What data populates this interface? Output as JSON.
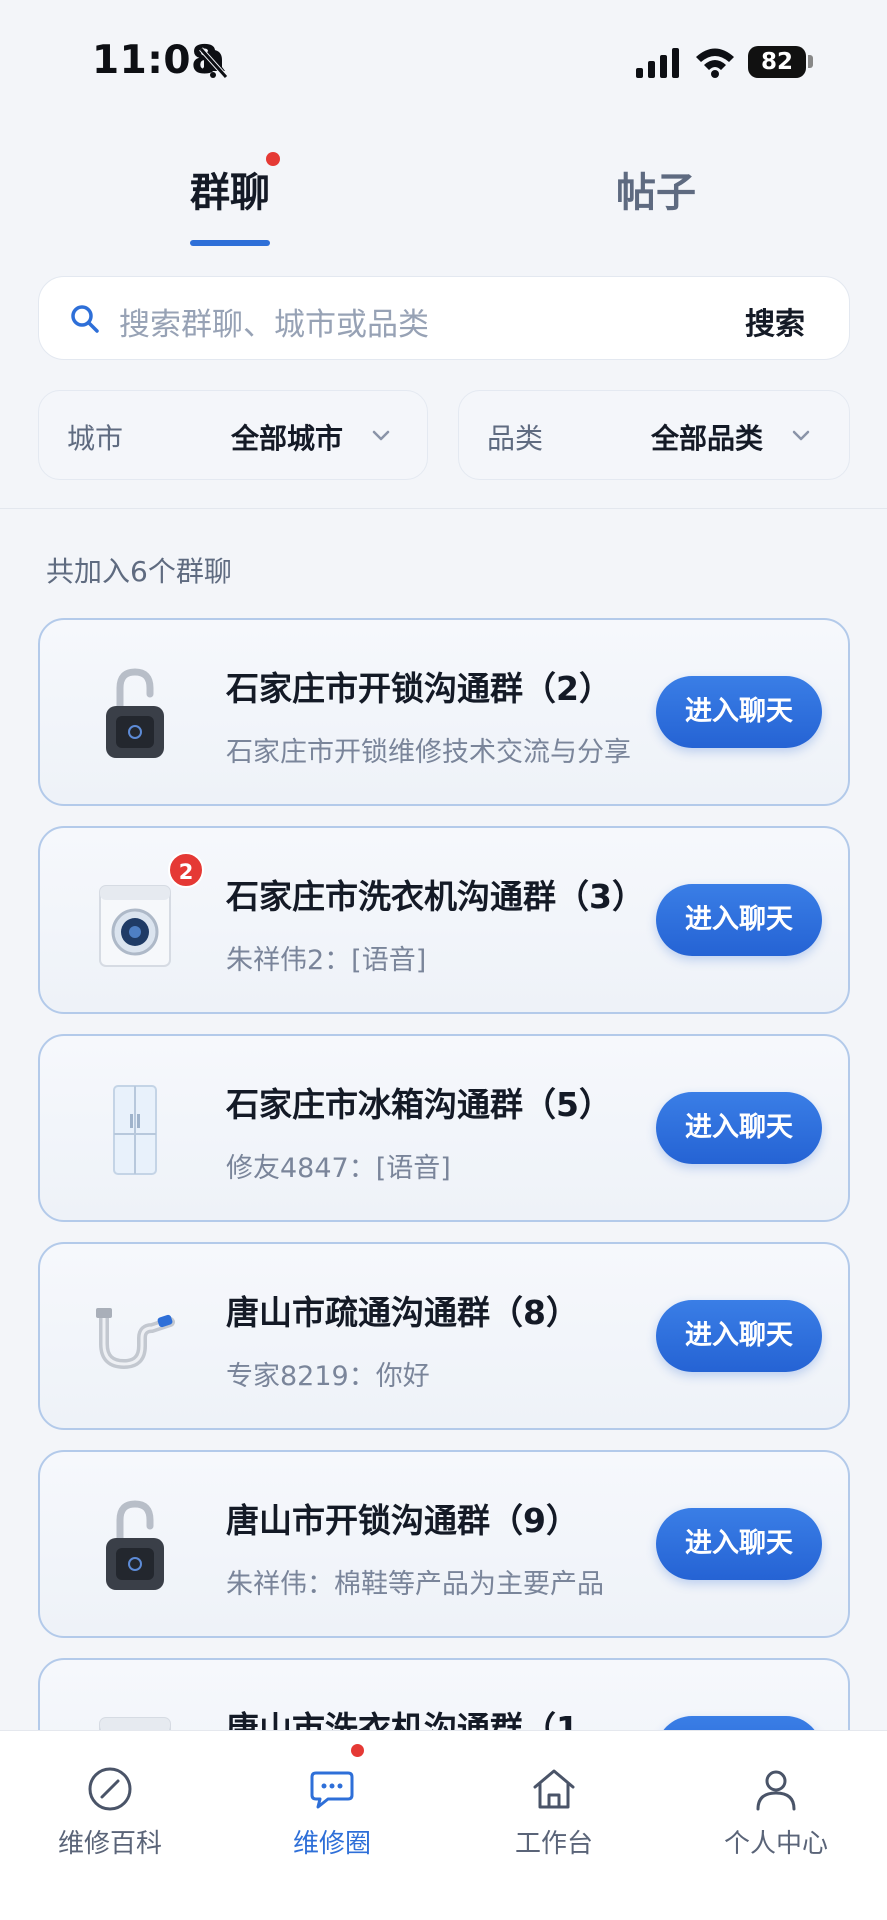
{
  "status": {
    "time": "11:08",
    "battery": "82"
  },
  "tabs": {
    "groups": "群聊",
    "posts": "帖子"
  },
  "search": {
    "placeholder": "搜索群聊、城市或品类",
    "button": "搜索"
  },
  "filters": {
    "city": {
      "label": "城市",
      "value": "全部城市"
    },
    "category": {
      "label": "品类",
      "value": "全部品类"
    }
  },
  "summary": "共加入6个群聊",
  "enter_label": "进入聊天",
  "groups": [
    {
      "title": "石家庄市开锁沟通群（2）",
      "subtitle": "石家庄市开锁维修技术交流与分享",
      "icon": "lock-icon"
    },
    {
      "title": "石家庄市洗衣机沟通群（3）",
      "subtitle": "朱祥伟2：[语音]",
      "icon": "washing-machine-icon",
      "badge": "2"
    },
    {
      "title": "石家庄市冰箱沟通群（5）",
      "subtitle": "修友4847：[语音]",
      "icon": "refrigerator-icon"
    },
    {
      "title": "唐山市疏通沟通群（8）",
      "subtitle": "专家8219：你好",
      "icon": "pipe-icon"
    },
    {
      "title": "唐山市开锁沟通群（9）",
      "subtitle": "朱祥伟：棉鞋等产品为主要产品",
      "icon": "lock-icon"
    },
    {
      "title": "唐山市洗衣机沟通群（1",
      "subtitle": "",
      "icon": "washing-machine-icon"
    }
  ],
  "bottom_nav": {
    "wiki": "维修百科",
    "circle": "维修圈",
    "workbench": "工作台",
    "profile": "个人中心"
  }
}
